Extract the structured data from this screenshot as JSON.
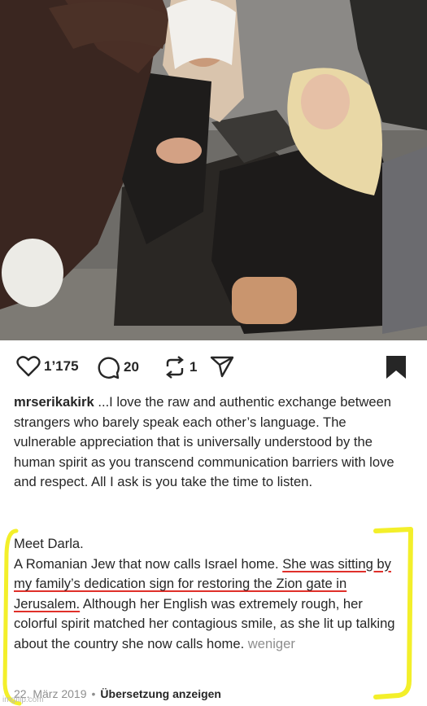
{
  "post": {
    "photo_alt": "",
    "likes": "1’175",
    "comments": "20",
    "reposts": "1",
    "icons": {
      "like": "heart-icon",
      "comment": "comment-bubble-icon",
      "repost": "repost-arrows-icon",
      "share": "paper-plane-icon",
      "save": "bookmark-icon"
    }
  },
  "caption": {
    "username": "mrserikakirk",
    "text1": " ...I love the raw and authentic exchange between strangers who barely speak each other’s language. The vulnerable appreciation that is universally understood by the human spirit as you transcend communication barriers with love and respect. All I ask is you take the time to listen.",
    "meet": "Meet Darla.",
    "p2_a": "A Romanian Jew that now calls Israel home. ",
    "p2_underlined": "She was sitting by my family’s dedication sign for restoring the Zion gate in Jerusalem.",
    "p2_b": " Although her English was extremely rough, her colorful spirit matched her contagious smile, as she lit up talking about the country she now calls home. ",
    "more": "weniger"
  },
  "meta": {
    "date": "22. März 2019",
    "separator": "•",
    "translate": "Übersetzung anzeigen"
  },
  "watermark": "imgflip.com",
  "colors": {
    "annotation_yellow": "#f3ef2a",
    "underline_red": "#e0302a",
    "text": "#262626",
    "muted": "#8e8e8e"
  }
}
